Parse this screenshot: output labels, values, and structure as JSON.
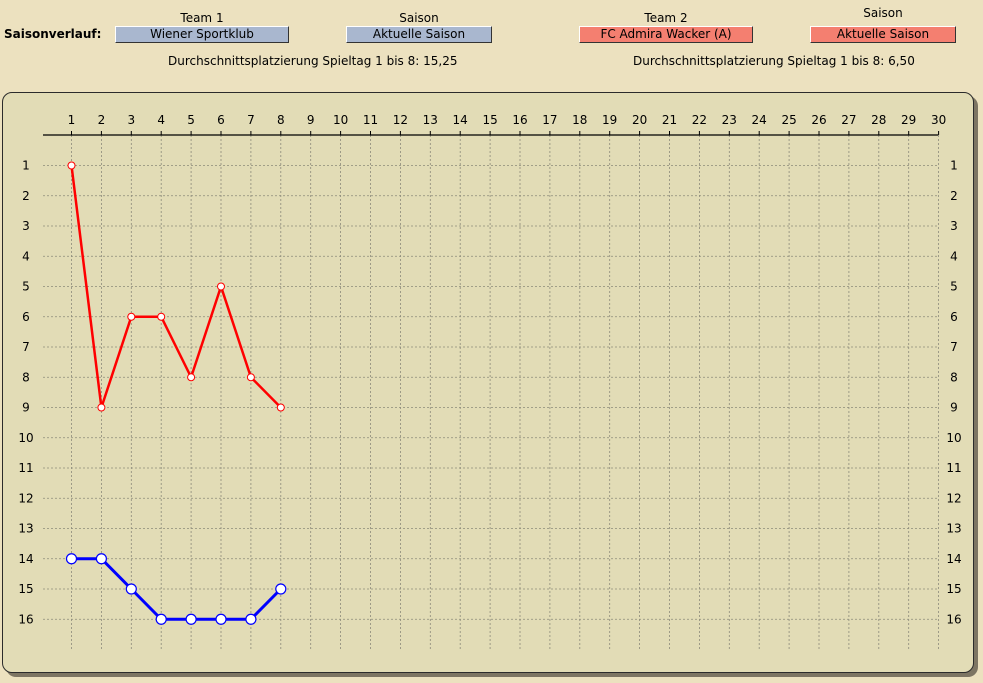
{
  "header": {
    "title": "Saisonverlauf:",
    "team1_label": "Team 1",
    "team1_value": "Wiener Sportklub",
    "season1_label": "Saison",
    "season1_value": "Aktuelle Saison",
    "team2_label": "Team 2",
    "team2_value": "FC Admira Wacker (A)",
    "season2_label": "Saison",
    "season2_value": "Aktuelle Saison",
    "avg1": "Durchschnittsplatzierung Spieltag 1 bis 8: 15,25",
    "avg2": "Durchschnittsplatzierung Spieltag 1 bis 8:  6,50"
  },
  "colors": {
    "team1": "#0000ff",
    "team2": "#ff0000",
    "panel": "#e2dcb6",
    "background": "#ece1bf"
  },
  "chart_data": {
    "type": "line",
    "x": [
      1,
      2,
      3,
      4,
      5,
      6,
      7,
      8
    ],
    "xlim": [
      1,
      30
    ],
    "ylim": [
      1,
      16
    ],
    "y_inverted": true,
    "grid": true,
    "series": [
      {
        "name": "FC Admira Wacker (A)",
        "color": "#ff0000",
        "values": [
          1,
          9,
          6,
          6,
          8,
          5,
          8,
          9
        ]
      },
      {
        "name": "Wiener Sportklub",
        "color": "#0000ff",
        "values": [
          14,
          14,
          15,
          16,
          16,
          16,
          16,
          15
        ]
      }
    ]
  }
}
